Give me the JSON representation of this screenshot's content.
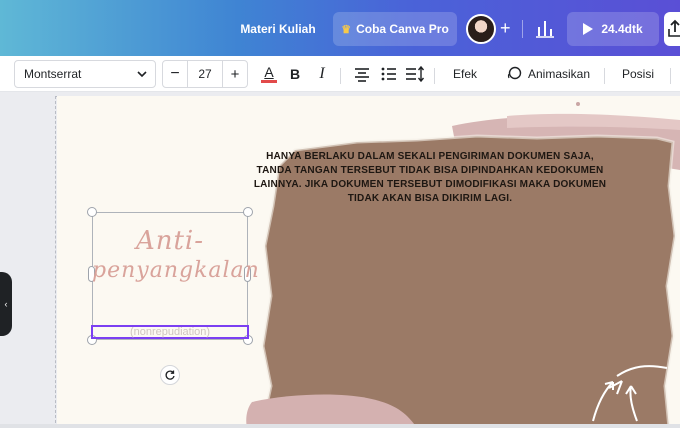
{
  "header": {
    "doc_title": "Materi Kuliah",
    "pro_label": "Coba Canva Pro",
    "pro_icon": "crown-icon",
    "add_collaborator": "+",
    "present_label": "24.4dtk",
    "gradient_colors": [
      "#5fb8d6",
      "#3f84d3",
      "#5a4fd6"
    ]
  },
  "toolbar": {
    "font_name": "Montserrat",
    "font_size": "27",
    "minus": "−",
    "plus": "+",
    "text_color_letter": "A",
    "bold": "B",
    "italic": "I",
    "effects": "Efek",
    "animate": "Animasikan",
    "position": "Posisi"
  },
  "canvas": {
    "script_title_line1": "Anti-",
    "script_title_line2": "penyangkalan",
    "subtitle": "(nonrepudiation)",
    "paper_text": "HANYA BERLAKU DALAM SEKALI PENGIRIMAN DOKUMEN SAJA, TANDA TANGAN TERSEBUT TIDAK BISA DIPINDAHKAN KEDOKUMEN LAINNYA. JIKA DOKUMEN TERSEBUT DIMODIFIKASI MAKA DOKUMEN TIDAK AKAN BISA DIKIRIM LAGI.",
    "paper_color": "#9b7a66",
    "pink_color": "#d4b1b0",
    "script_color": "#d9a39b"
  }
}
